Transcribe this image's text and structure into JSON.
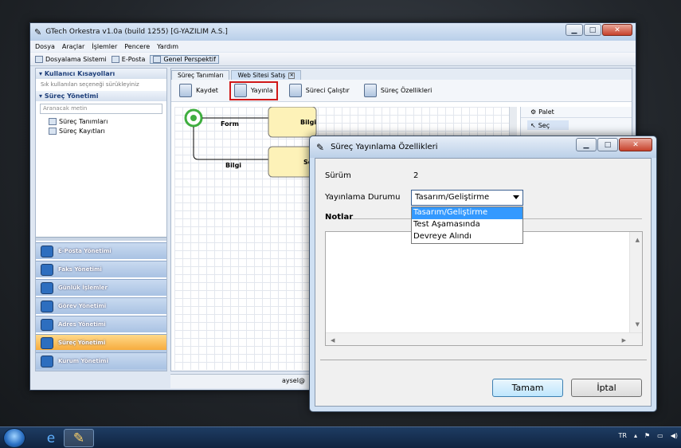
{
  "main_window": {
    "title": "GTech Orkestra v1.0a (build 1255) [G-YAZILIM A.S.]",
    "menu": [
      "Dosya",
      "Araçlar",
      "İşlemler",
      "Pencere",
      "Yardım"
    ],
    "toolbar": [
      "Dosyalama Sistemi",
      "E-Posta",
      "Genel Perspektif"
    ]
  },
  "left_panel": {
    "shortcuts_header": "Kullanıcı Kısayolları",
    "shortcuts_hint": "Sık kullanılan seçeneği sürükleyiniz",
    "process_header": "Süreç Yönetimi",
    "search_placeholder": "Aranacak metin",
    "tree": [
      "Süreç Tanımları",
      "Süreç Kayıtları"
    ],
    "nav": [
      "E-Posta Yönetimi",
      "Faks Yönetimi",
      "Günlük İşlemler",
      "Görev Yönetimi",
      "Adres Yönetimi",
      "Süreç Yönetimi",
      "Kurum Yönetimi"
    ]
  },
  "editor": {
    "tabs": [
      "Süreç Tanımları",
      "Web Sitesi Satış"
    ],
    "toolbar": {
      "save": "Kaydet",
      "publish": "Yayınla",
      "run": "Süreci Çalıştır",
      "props": "Süreç Özellikleri"
    },
    "flow": {
      "edge1": "Form",
      "edge2": "Bilgi",
      "node1": "Bilgi",
      "node2": "Se"
    },
    "palette": {
      "header": "Palet",
      "select": "Seç"
    },
    "status_user": "aysel@"
  },
  "dialog": {
    "title": "Süreç Yayınlama Özellikleri",
    "version_label": "Sürüm",
    "version_value": "2",
    "status_label": "Yayınlama Durumu",
    "status_value": "Tasarım/Geliştirme",
    "options": [
      "Tasarım/Geliştirme",
      "Test Aşamasında",
      "Devreye Alındı"
    ],
    "notes_label": "Notlar",
    "ok": "Tamam",
    "cancel": "İptal"
  },
  "taskbar": {
    "lang": "TR"
  },
  "colors": {
    "highlight_border": "#d01818",
    "selected_option": "#3399ff",
    "selected_nav": "#f6a93a"
  }
}
